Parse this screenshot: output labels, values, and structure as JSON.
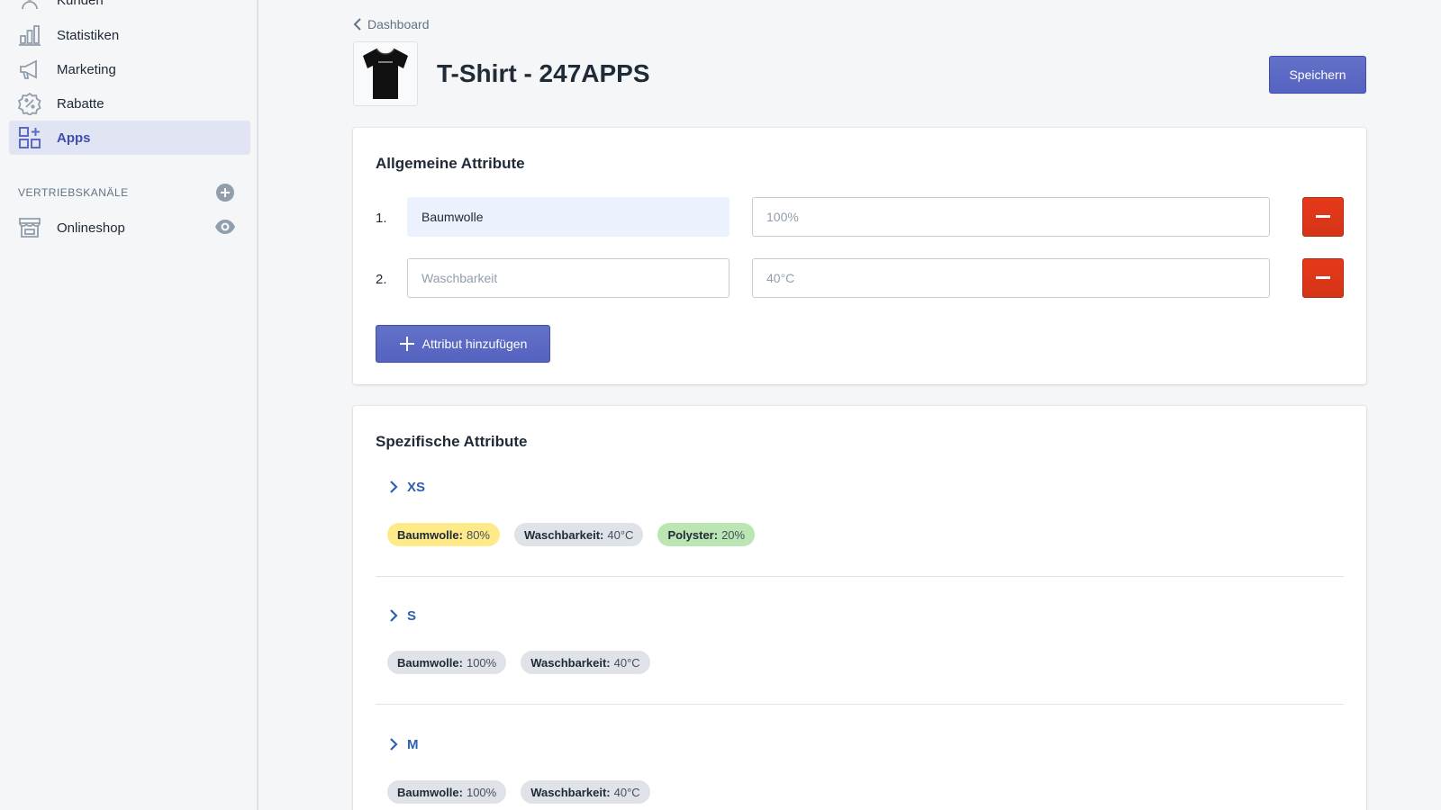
{
  "sidebar": {
    "items": [
      {
        "id": "kunden",
        "label": "Kunden",
        "icon": "customer-icon"
      },
      {
        "id": "statistiken",
        "label": "Statistiken",
        "icon": "bar-chart-icon"
      },
      {
        "id": "marketing",
        "label": "Marketing",
        "icon": "megaphone-icon"
      },
      {
        "id": "rabatte",
        "label": "Rabatte",
        "icon": "discount-icon"
      },
      {
        "id": "apps",
        "label": "Apps",
        "icon": "apps-icon",
        "active": true
      }
    ],
    "channels_label": "VERTRIEBSKANÄLE",
    "channels": [
      {
        "label": "Onlineshop",
        "icon": "store-icon"
      }
    ]
  },
  "header": {
    "breadcrumb": "Dashboard",
    "title": "T-Shirt - 247APPS",
    "save_label": "Speichern"
  },
  "general": {
    "title": "Allgemeine Attribute",
    "rows": [
      {
        "num": "1.",
        "name_value": "Baumwolle",
        "name_placeholder": "",
        "value_value": "",
        "value_placeholder": "100%"
      },
      {
        "num": "2.",
        "name_value": "",
        "name_placeholder": "Waschbarkeit",
        "value_value": "",
        "value_placeholder": "40°C"
      }
    ],
    "add_label": "Attribut hinzufügen"
  },
  "specific": {
    "title": "Spezifische Attribute",
    "variants": [
      {
        "label": "XS",
        "badges": [
          {
            "key": "Baumwolle:",
            "val": "80%",
            "color": "yellow"
          },
          {
            "key": "Waschbarkeit:",
            "val": "40°C",
            "color": "gray"
          },
          {
            "key": "Polyster:",
            "val": "20%",
            "color": "green"
          }
        ]
      },
      {
        "label": "S",
        "badges": [
          {
            "key": "Baumwolle:",
            "val": "100%",
            "color": "gray"
          },
          {
            "key": "Waschbarkeit:",
            "val": "40°C",
            "color": "gray"
          }
        ]
      },
      {
        "label": "M",
        "badges": [
          {
            "key": "Baumwolle:",
            "val": "100%",
            "color": "gray"
          },
          {
            "key": "Waschbarkeit:",
            "val": "40°C",
            "color": "gray"
          }
        ]
      }
    ]
  },
  "colors": {
    "primary": "#5c6ac4",
    "danger": "#de3618",
    "sidebar_active": "#e1e5f3"
  }
}
